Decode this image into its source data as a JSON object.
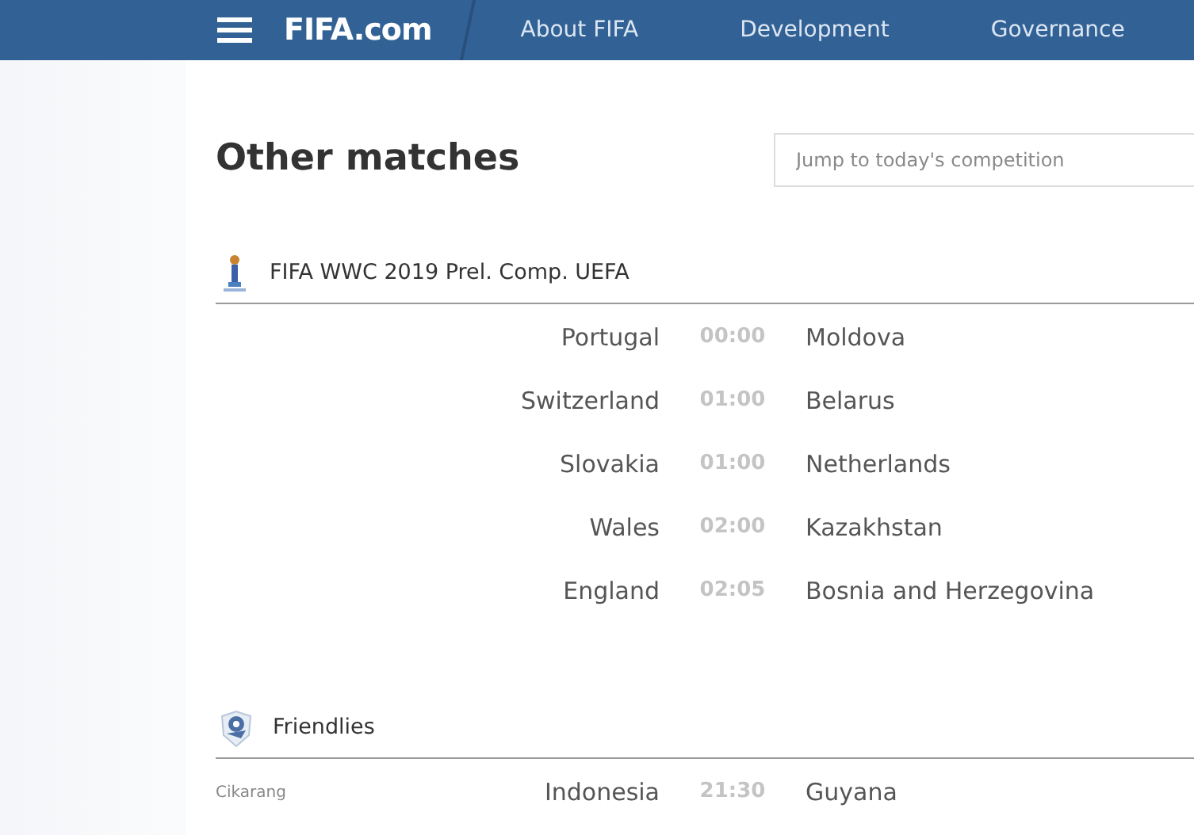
{
  "navbar": {
    "logo": "FIFA.com",
    "links": [
      "About FIFA",
      "Development",
      "Governance"
    ]
  },
  "page": {
    "title": "Other matches",
    "search": {
      "placeholder": "Jump to today's competition"
    }
  },
  "competitions": [
    {
      "name": "FIFA WWC 2019 Prel. Comp. UEFA",
      "matches": [
        {
          "home": "Portugal",
          "time": "00:00",
          "away": "Moldova"
        },
        {
          "home": "Switzerland",
          "time": "01:00",
          "away": "Belarus"
        },
        {
          "home": "Slovakia",
          "time": "01:00",
          "away": "Netherlands"
        },
        {
          "home": "Wales",
          "time": "02:00",
          "away": "Kazakhstan"
        },
        {
          "home": "England",
          "time": "02:05",
          "away": "Bosnia and Herzegovina"
        }
      ]
    },
    {
      "name": "Friendlies",
      "matches": [
        {
          "venue": "Cikarang",
          "home": "Indonesia",
          "time": "21:30",
          "away": "Guyana"
        }
      ]
    }
  ]
}
